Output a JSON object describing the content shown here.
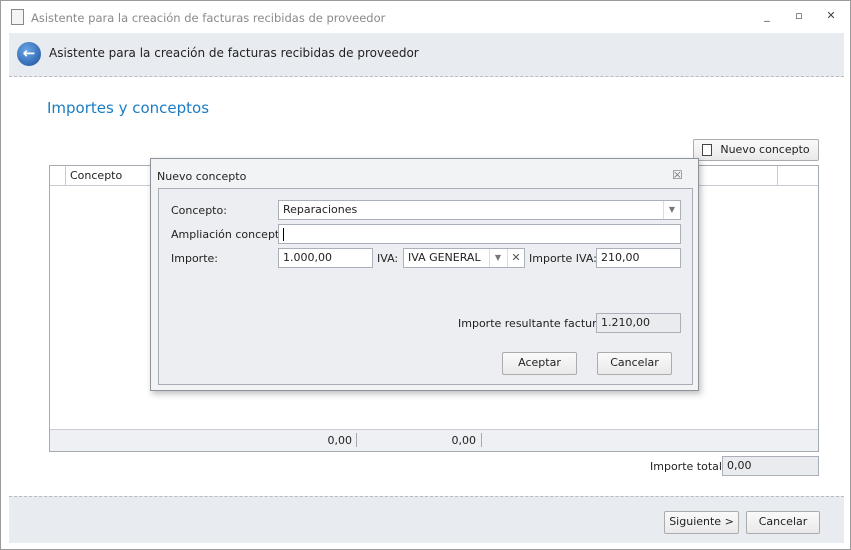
{
  "window": {
    "title": "Asistente para la creación de facturas recibidas de proveedor",
    "minimize": "_",
    "restore": "▫",
    "close": "✕"
  },
  "header": {
    "title": "Asistente para la creación de facturas recibidas de proveedor"
  },
  "section": {
    "title": "Importes y conceptos"
  },
  "toolbar": {
    "new_concept": "Nuevo concepto"
  },
  "grid": {
    "columns": [
      "Concepto"
    ],
    "totals": [
      "0,00",
      "0,00"
    ]
  },
  "total": {
    "label": "Importe total:",
    "value": "0,00"
  },
  "footer": {
    "next": "Siguiente >",
    "cancel": "Cancelar"
  },
  "dialog": {
    "title": "Nuevo concepto",
    "close": "☒",
    "concepto_label": "Concepto:",
    "concepto_value": "Reparaciones",
    "ampliacion_label": "Ampliación concepto:",
    "ampliacion_value": "",
    "importe_label": "Importe:",
    "importe_value": "1.000,00",
    "iva_label": "IVA:",
    "iva_value": "IVA GENERAL",
    "importe_iva_label": "Importe IVA:",
    "importe_iva_value": "210,00",
    "resultante_label": "Importe resultante factura:",
    "resultante_value": "1.210,00",
    "accept": "Aceptar",
    "cancel": "Cancelar"
  }
}
